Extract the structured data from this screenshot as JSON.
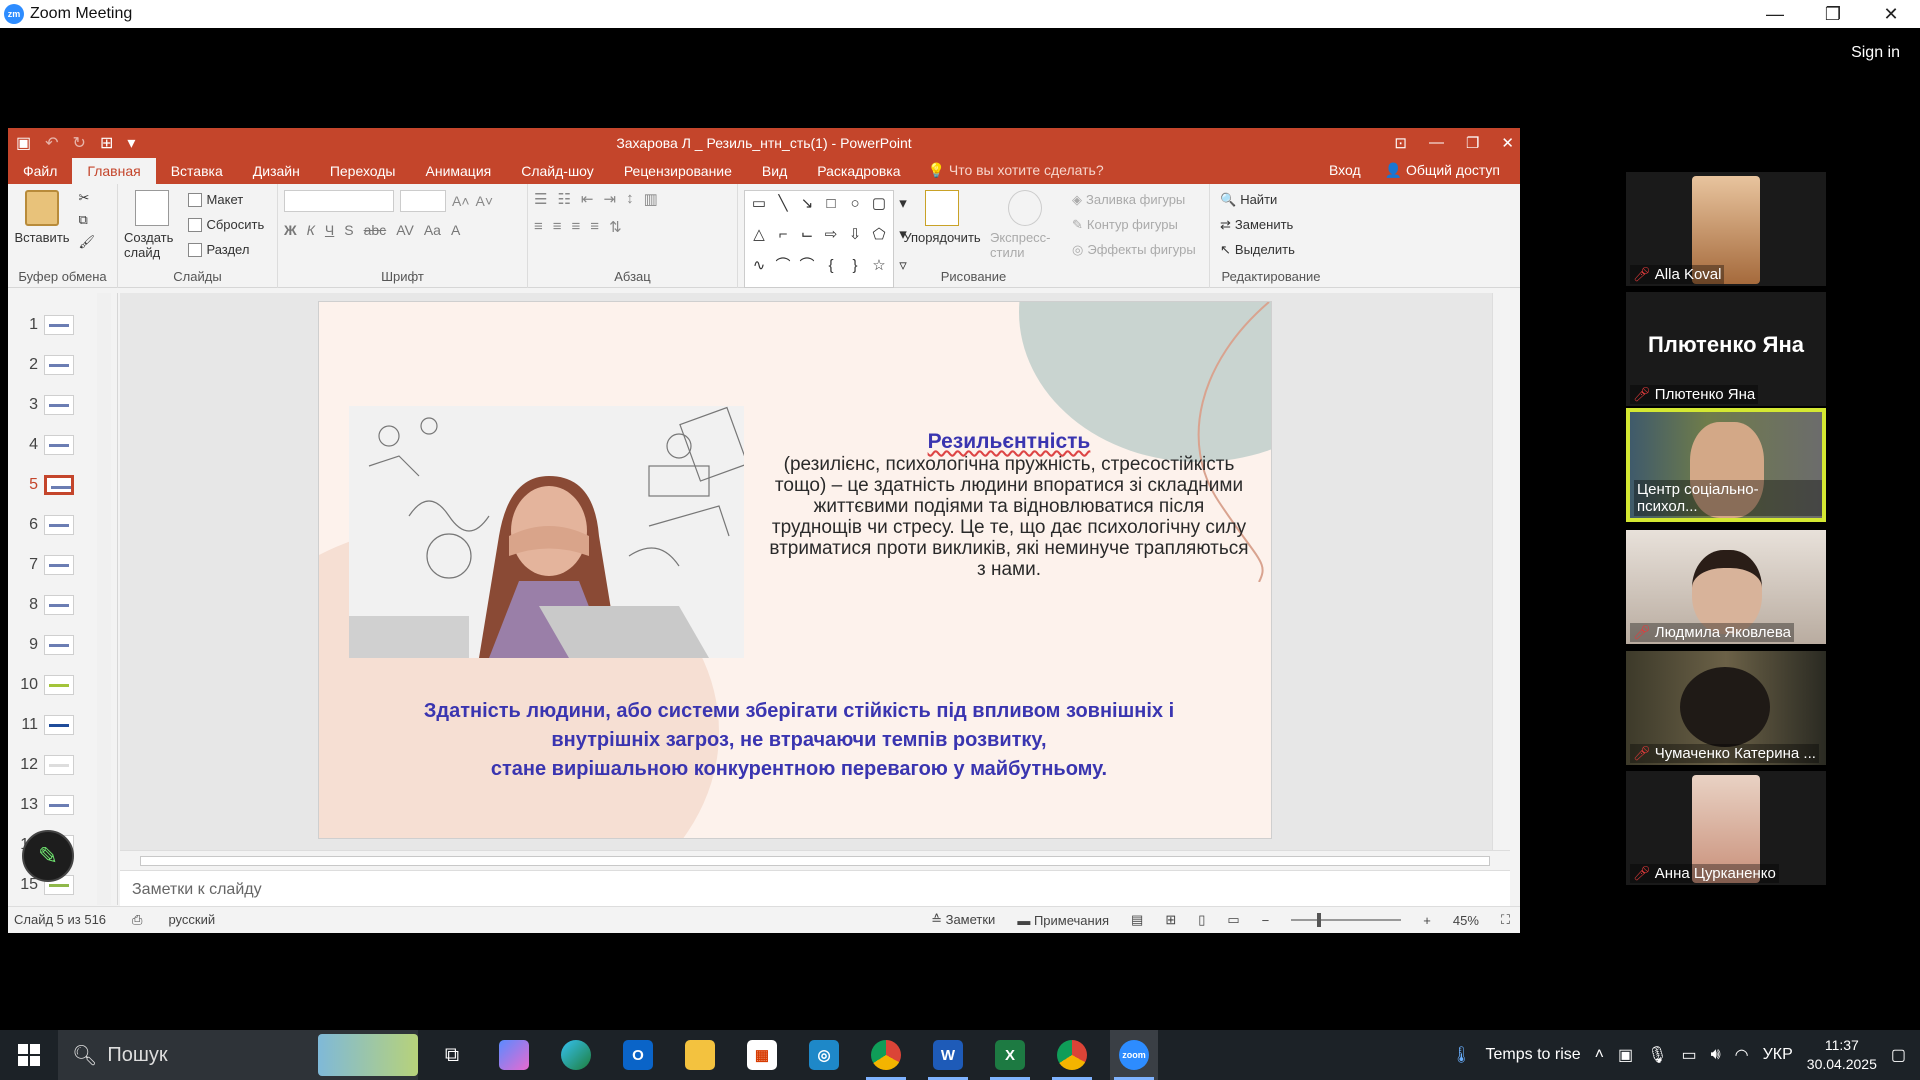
{
  "zoom": {
    "window_title": "Zoom Meeting",
    "sign_in": "Sign in",
    "controls": {
      "minimize": "—",
      "restore": "❐",
      "close": "✕"
    }
  },
  "ppt": {
    "doc_title": "Захарова Л _ Резиль_нтн_сть(1) - PowerPoint",
    "tabs": [
      "Файл",
      "Главная",
      "Вставка",
      "Дизайн",
      "Переходы",
      "Анимация",
      "Слайд-шоу",
      "Рецензирование",
      "Вид",
      "Раскадровка"
    ],
    "active_tab": "Главная",
    "tell_me": "Что вы хотите сделать?",
    "login": "Вход",
    "share": "Общий доступ",
    "ribbon": {
      "clipboard": {
        "paste": "Вставить",
        "label": "Буфер обмена"
      },
      "slides": {
        "new_slide": "Создать слайд",
        "layout": "Макет",
        "reset": "Сбросить",
        "section": "Раздел",
        "label": "Слайды"
      },
      "font": {
        "label": "Шрифт",
        "format_row": [
          "Ж",
          "К",
          "Ч",
          "S",
          "abc",
          "AV",
          "Aa",
          "A"
        ]
      },
      "paragraph": {
        "label": "Абзац"
      },
      "drawing": {
        "arrange": "Упорядочить",
        "quick_styles": "Экспресс-стили",
        "fill": "Заливка фигуры",
        "outline": "Контур фигуры",
        "effects": "Эффекты фигуры",
        "label": "Рисование"
      },
      "editing": {
        "find": "Найти",
        "replace": "Заменить",
        "select": "Выделить",
        "label": "Редактирование"
      }
    },
    "slide_numbers": [
      "1",
      "2",
      "3",
      "4",
      "5",
      "6",
      "7",
      "8",
      "9",
      "10",
      "11",
      "12",
      "13",
      "14",
      "15"
    ],
    "active_slide": "5",
    "slide": {
      "title": "Резильєнтність",
      "body": "(резилієнс, психологічна пружність, стресостійкість тощо) – це здатність людини впоратися зі складними життєвими подіями та відновлюватися після труднощів чи стресу. Це те, що дає психологічну силу втриматися проти викликів, які неминуче трапляються з нами.",
      "bottom_lines": [
        "Здатність людини, або системи зберігати стійкість під впливом зовнішніх і",
        "внутрішніх загроз, не втрачаючи темпів розвитку,",
        "стане вирішальною конкурентною перевагою у майбутньому."
      ]
    },
    "notes_placeholder": "Заметки к слайду",
    "status": {
      "slide_info": "Слайд 5 из 516",
      "language": "русский",
      "notes": "Заметки",
      "comments": "Примечания",
      "zoom": "45%"
    }
  },
  "participants": [
    {
      "name": "Alla Koval",
      "muted": true
    },
    {
      "name": "Плютенко Яна",
      "big_name": "Плютенко Яна",
      "muted": true
    },
    {
      "name": "Центр соціально-психол...",
      "muted": false,
      "active": true
    },
    {
      "name": "Людмила Яковлева",
      "muted": true
    },
    {
      "name": "Чумаченко Катерина ...",
      "muted": true
    },
    {
      "name": "Анна Цурканенко",
      "muted": true
    }
  ],
  "taskbar": {
    "search": "Пошук",
    "weather": "Temps to rise",
    "lang": "УКР",
    "time": "11:37",
    "date": "30.04.2025"
  },
  "colors": {
    "ppt_accent": "#c4452b",
    "slide_title": "#3a35b0",
    "active_speaker": "#d4e832"
  }
}
